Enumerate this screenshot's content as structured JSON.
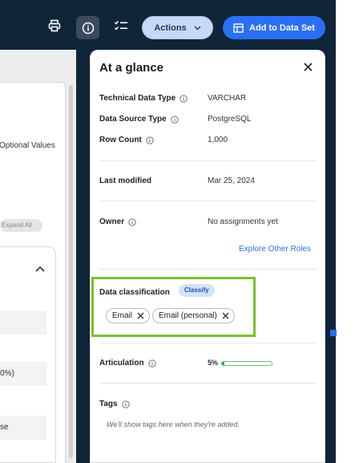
{
  "toolbar": {
    "actions_label": "Actions",
    "add_label": "Add to Data Set"
  },
  "left": {
    "optional_values": "Optional Values",
    "expand_all": "Expand All",
    "row_pct": "0%)",
    "row_se": "se"
  },
  "panel": {
    "title": "At a glance",
    "technical_data_type": {
      "label": "Technical Data Type",
      "value": "VARCHAR"
    },
    "data_source_type": {
      "label": "Data Source Type",
      "value": "PostgreSQL"
    },
    "row_count": {
      "label": "Row Count",
      "value": "1,000"
    },
    "last_modified": {
      "label": "Last modified",
      "value": "Mar 25, 2024"
    },
    "owner": {
      "label": "Owner",
      "value": "No assignments yet",
      "link": "Explore Other Roles"
    },
    "classification": {
      "label": "Data classification",
      "badge": "Classify",
      "chips": [
        "Email",
        "Email (personal)"
      ]
    },
    "articulation": {
      "label": "Articulation",
      "value": "5%",
      "progress": 0.05
    },
    "tags": {
      "label": "Tags",
      "empty": "We'll show tags here when they're added."
    }
  },
  "colors": {
    "topbar": "#102538",
    "primary": "#2b6ff5",
    "highlight": "#7cc02c",
    "progress": "#2fa54a"
  }
}
